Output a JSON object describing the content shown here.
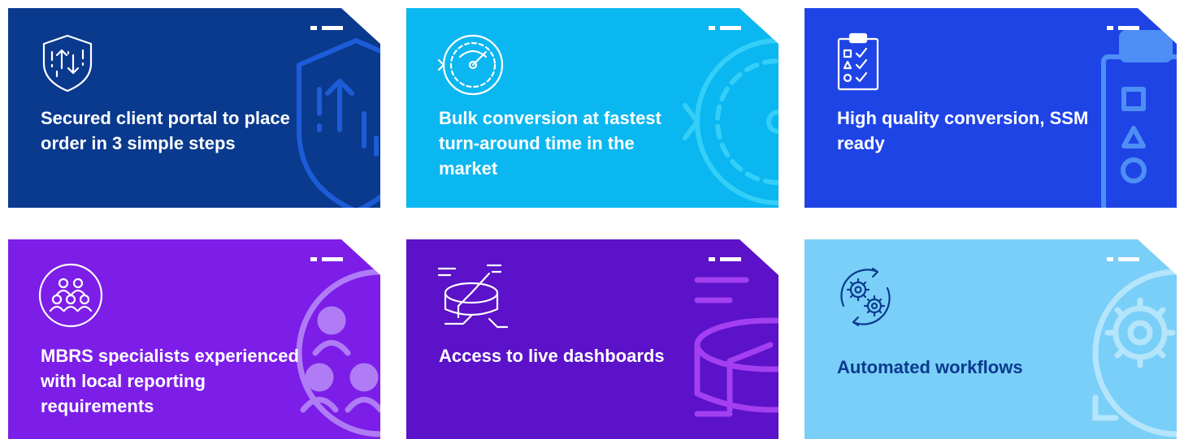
{
  "cards": [
    {
      "title": "Secured client portal to place order in 3 simple steps",
      "icon": "shield-upload-icon",
      "color": "#0a3a8e"
    },
    {
      "title": "Bulk conversion at fastest turn-around time in the market",
      "icon": "speedometer-icon",
      "color": "#0bb7f0"
    },
    {
      "title": "High quality conversion, SSM ready",
      "icon": "clipboard-checklist-icon",
      "color": "#1f44e6"
    },
    {
      "title": "MBRS specialists experienced with local reporting requirements",
      "icon": "people-group-icon",
      "color": "#7c1ee8"
    },
    {
      "title": "Access to live dashboards",
      "icon": "pie-chart-icon",
      "color": "#5b12c8"
    },
    {
      "title": "Automated workflows",
      "icon": "gears-cycle-icon",
      "color": "#79cff8"
    }
  ]
}
